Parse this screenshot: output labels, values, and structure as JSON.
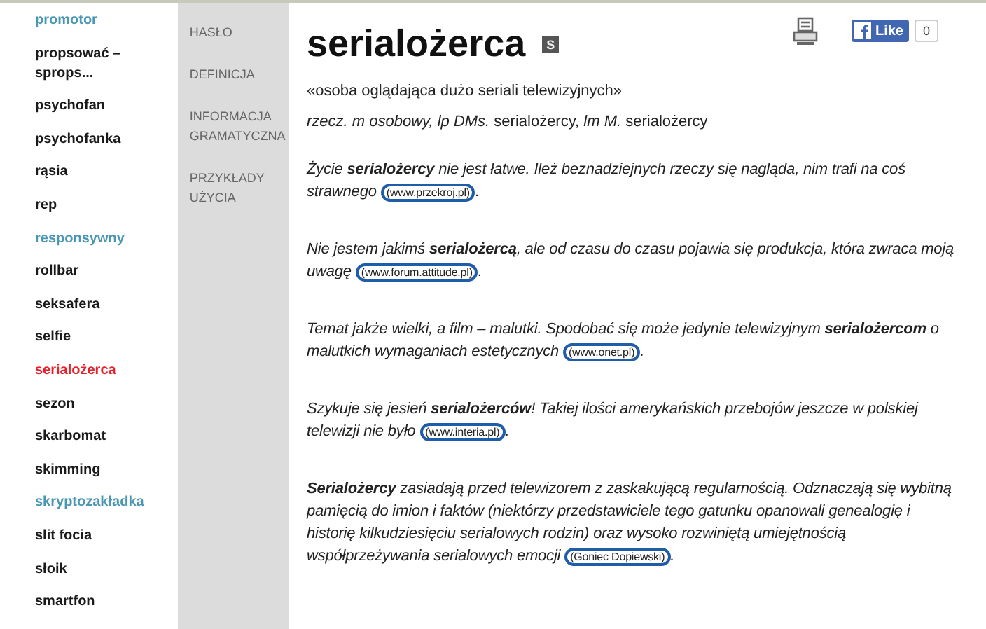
{
  "word_list": [
    {
      "label": "promotor",
      "color": "#4a97b3"
    },
    {
      "label": "propsować – sprops...",
      "color": "#1a1a1a"
    },
    {
      "label": "psychofan",
      "color": "#1a1a1a"
    },
    {
      "label": "psychofanka",
      "color": "#1a1a1a"
    },
    {
      "label": "rąsia",
      "color": "#1a1a1a"
    },
    {
      "label": "rep",
      "color": "#1a1a1a"
    },
    {
      "label": "responsywny",
      "color": "#4a97b3"
    },
    {
      "label": "rollbar",
      "color": "#1a1a1a"
    },
    {
      "label": "seksafera",
      "color": "#1a1a1a"
    },
    {
      "label": "selfie",
      "color": "#1a1a1a"
    },
    {
      "label": "serialożerca",
      "color": "#e8202a"
    },
    {
      "label": "sezon",
      "color": "#1a1a1a"
    },
    {
      "label": "skarbomat",
      "color": "#1a1a1a"
    },
    {
      "label": "skimming",
      "color": "#1a1a1a"
    },
    {
      "label": "skryptozakładka",
      "color": "#4a97b3"
    },
    {
      "label": "slit focia",
      "color": "#1a1a1a"
    },
    {
      "label": "słoik",
      "color": "#1a1a1a"
    },
    {
      "label": "smartfon",
      "color": "#1a1a1a"
    }
  ],
  "section_nav": [
    "HASŁO",
    "DEFINICJA",
    "INFORMACJA GRAMATYCZNA",
    "PRZYKŁADY UŻYCIA"
  ],
  "entry": {
    "headword": "serialożerca",
    "badge": "S",
    "definition": "«osoba oglądająca dużo seriali telewizyjnych»",
    "grammar": "*rzecz. m osobowy, lp DMs.* serialożercy, *lm M.* serialożercy"
  },
  "like_button": {
    "label": "Like",
    "count": "0"
  },
  "examples": [
    {
      "text": "Życie **serialożercy** nie jest łatwe. Ileż beznadziejnych rzeczy się nagląda, nim trafi na coś strawnego",
      "source": "(www.przekroj.pl)",
      "end": "."
    },
    {
      "text": "Nie jestem jakimś **serialożercą**, ale od czasu do czasu pojawia się produkcja, która zwraca moją uwagę",
      "source": "(www.forum.attitude.pl)",
      "end": "."
    },
    {
      "text": "Temat jakże wielki, a film – malutki. Spodobać się może jedynie telewizyjnym **serialożercom** o malutkich wymaganiach estetycznych",
      "source": "(www.onet.pl)",
      "end": "."
    },
    {
      "text": "Szykuje się jesień **serialożerców**! Takiej ilości amerykańskich przebojów jeszcze w polskiej telewizji nie było",
      "source": "(www.interia.pl)",
      "end": "."
    },
    {
      "text": "**Serialożercy** zasiadają przed telewizorem z zaskakującą regularnością. Odznaczają się wybitną pamięcią do imion i faktów (niektórzy przedstawiciele tego gatunku opanowali genealogię i historię kilkudziesięciu serialowych rodzin) oraz wysoko rozwiniętą umiejętnością współprzeżywania serialowych emocji",
      "source": "(Goniec Dopiewski)",
      "end": "."
    }
  ]
}
